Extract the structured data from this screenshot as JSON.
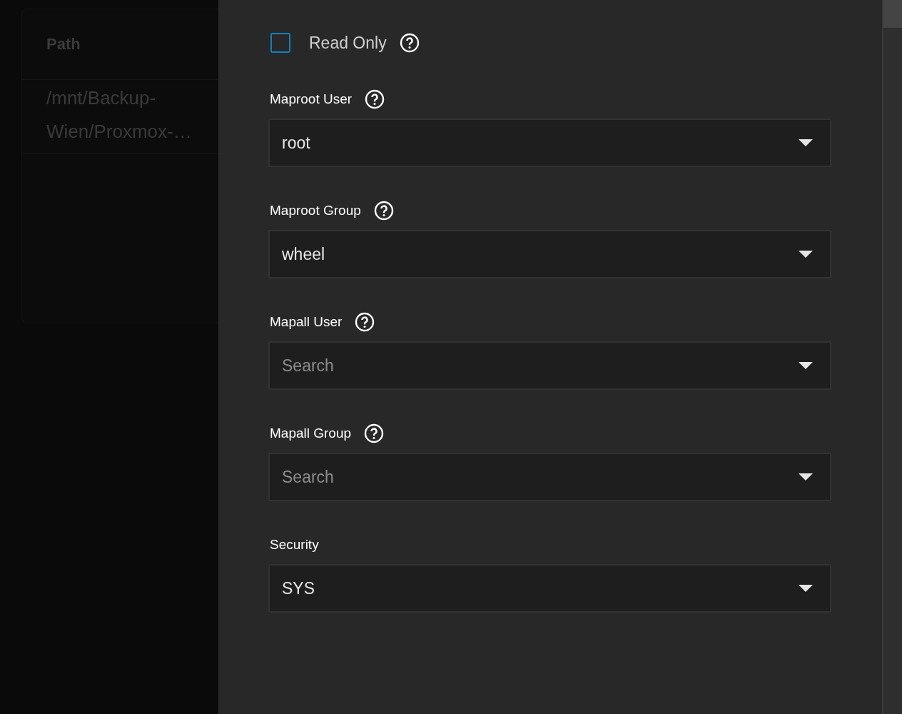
{
  "background_table": {
    "columns": [
      "Path"
    ],
    "rows": [
      [
        "/mnt/Backup-Wien/Proxmox-…"
      ]
    ]
  },
  "read_only": {
    "label": "Read Only",
    "checked": false,
    "help": true
  },
  "fields": [
    {
      "label": "Maproot User",
      "help": true,
      "value": "root"
    },
    {
      "label": "Maproot Group",
      "help": true,
      "value": "wheel"
    },
    {
      "label": "Mapall User",
      "help": true,
      "placeholder": "Search"
    },
    {
      "label": "Mapall Group",
      "help": true,
      "placeholder": "Search"
    },
    {
      "label": "Security",
      "help": false,
      "value": "SYS"
    }
  ]
}
